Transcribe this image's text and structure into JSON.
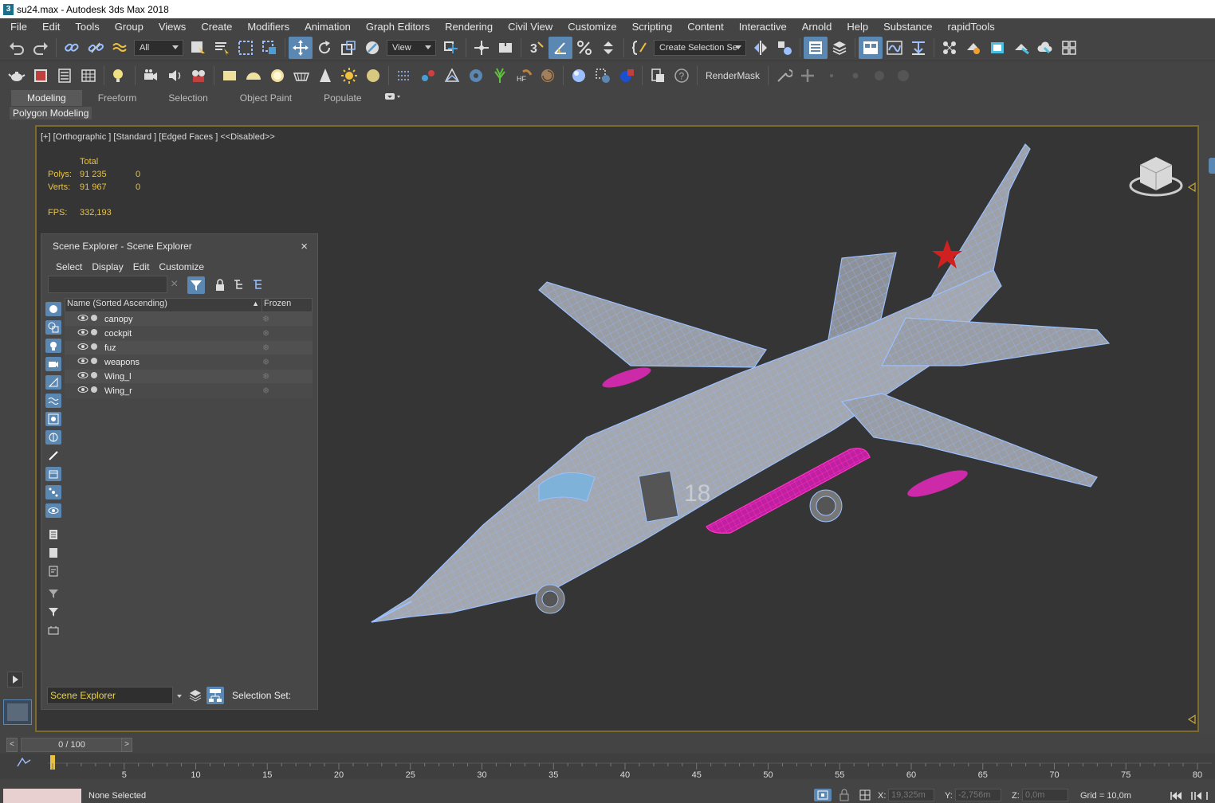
{
  "window": {
    "title": "su24.max - Autodesk 3ds Max 2018",
    "icon_label": "3"
  },
  "menu": [
    "File",
    "Edit",
    "Tools",
    "Group",
    "Views",
    "Create",
    "Modifiers",
    "Animation",
    "Graph Editors",
    "Rendering",
    "Civil View",
    "Customize",
    "Scripting",
    "Content",
    "Interactive",
    "Arnold",
    "Help",
    "Substance",
    "rapidTools"
  ],
  "toolbar": {
    "selection_filter": "All",
    "reference_coord": "View",
    "create_selection_set": "Create Selection Se",
    "render_mask": "RenderMask",
    "snap_label": "3"
  },
  "ribbon": {
    "tabs": [
      "Modeling",
      "Freeform",
      "Selection",
      "Object Paint",
      "Populate"
    ],
    "active": "Modeling",
    "panel": "Polygon Modeling"
  },
  "viewport": {
    "label": "[+] [Orthographic ] [Standard ] [Edged Faces ]  <<Disabled>>",
    "stats": {
      "total_header": "Total",
      "polys_label": "Polys:",
      "polys_total": "91 235",
      "polys_sel": "0",
      "verts_label": "Verts:",
      "verts_total": "91 967",
      "verts_sel": "0",
      "fps_label": "FPS:",
      "fps": "332,193"
    },
    "model_marking": "18"
  },
  "scene_explorer": {
    "title": "Scene Explorer - Scene Explorer",
    "close": "×",
    "menu": [
      "Select",
      "Display",
      "Edit",
      "Customize"
    ],
    "column_name": "Name (Sorted Ascending)",
    "sort_indicator": "▲",
    "column_frozen": "Frozen",
    "rows": [
      {
        "name": "canopy"
      },
      {
        "name": "cockpit"
      },
      {
        "name": "fuz"
      },
      {
        "name": "weapons"
      },
      {
        "name": "Wing_l"
      },
      {
        "name": "Wing_r"
      }
    ],
    "explorer_combo": "Scene Explorer",
    "selection_set_label": "Selection Set:",
    "clear_icon": "×"
  },
  "timeline": {
    "frame_counter": "0 / 100",
    "prev": "<",
    "next": ">",
    "ticks": [
      "5",
      "10",
      "15",
      "20",
      "25",
      "30",
      "35",
      "40",
      "45",
      "50",
      "55",
      "60",
      "65",
      "70",
      "75",
      "80"
    ]
  },
  "status": {
    "selection": "None Selected",
    "x_label": "X:",
    "x_value": "19,325m",
    "y_label": "Y:",
    "y_value": "-2,756m",
    "z_label": "Z:",
    "z_value": "0,0m",
    "grid": "Grid = 10,0m"
  },
  "colors": {
    "accent": "#5b87b3",
    "viewport_border": "#7e6a2a",
    "stats": "#e6c24a",
    "wire": "#9cc0ff",
    "weapons": "#ff33c8"
  }
}
